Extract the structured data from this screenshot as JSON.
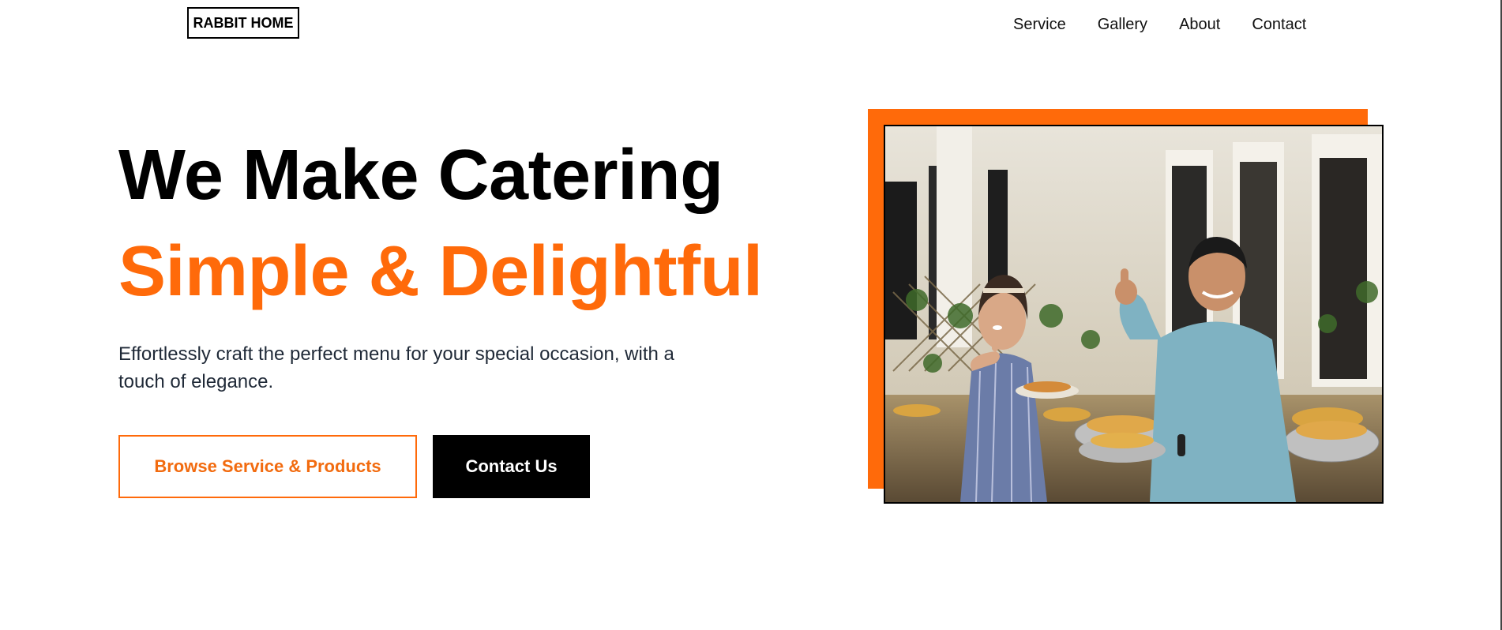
{
  "header": {
    "logo_text": "RABBIT HOME",
    "nav": [
      {
        "label": "Service"
      },
      {
        "label": "Gallery"
      },
      {
        "label": "About"
      },
      {
        "label": "Contact"
      }
    ]
  },
  "hero": {
    "title": "We Make Catering",
    "subtitle": "Simple & Delightful",
    "description": "Effortlessly craft the perfect menu for your special occasion, with a touch of elegance.",
    "primary_button": "Browse Service & Products",
    "secondary_button": "Contact Us"
  },
  "image": {
    "alt": "Two people giving thumbs up beside a catering buffet"
  },
  "colors": {
    "accent": "#ff6a0a",
    "dark": "#000000",
    "text": "#1f2937"
  }
}
